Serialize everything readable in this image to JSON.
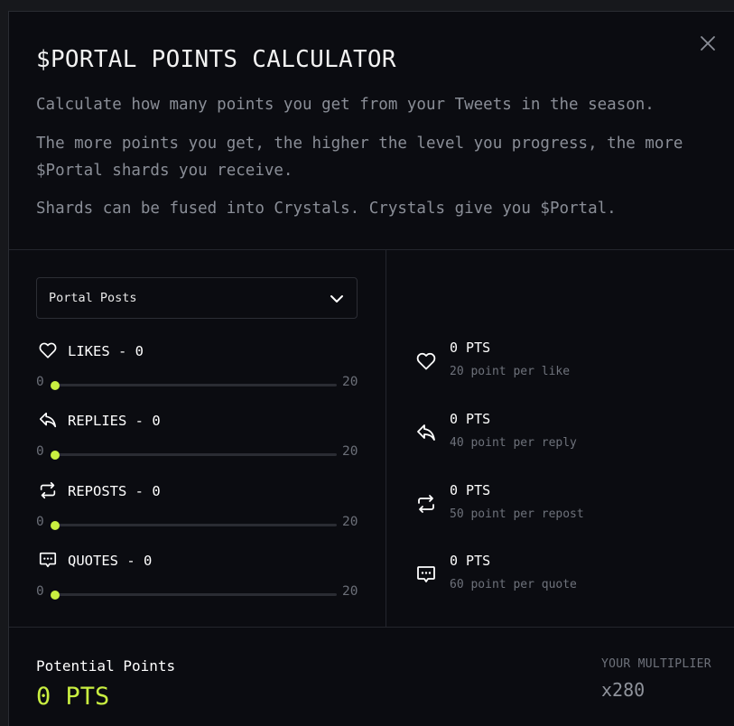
{
  "modal": {
    "title": "$PORTAL POINTS CALCULATOR",
    "paragraphs": [
      "Calculate how many points you get from your Tweets in the season.",
      "The more points you get, the higher the level you progress, the more $Portal shards you receive.",
      "Shards can be fused into Crystals. Crystals give you $Portal."
    ],
    "close_icon": "close-icon"
  },
  "dropdown": {
    "selected": "Portal Posts",
    "icon": "chevron-down-icon"
  },
  "metrics": [
    {
      "label": "LIKES - 0",
      "icon": "heart-icon",
      "min": "0",
      "max": "20",
      "value": 0
    },
    {
      "label": "REPLIES - 0",
      "icon": "reply-icon",
      "min": "0",
      "max": "20",
      "value": 0
    },
    {
      "label": "REPOSTS - 0",
      "icon": "repost-icon",
      "min": "0",
      "max": "20",
      "value": 0
    },
    {
      "label": "QUOTES - 0",
      "icon": "quote-icon",
      "min": "0",
      "max": "20",
      "value": 0
    }
  ],
  "points": [
    {
      "value": "0 PTS",
      "desc": "20 point per like",
      "icon": "heart-icon"
    },
    {
      "value": "0 PTS",
      "desc": "40 point per reply",
      "icon": "reply-icon"
    },
    {
      "value": "0 PTS",
      "desc": "50 point per repost",
      "icon": "repost-icon"
    },
    {
      "value": "0 PTS",
      "desc": "60 point per quote",
      "icon": "quote-icon"
    }
  ],
  "footer": {
    "potential_label": "Potential Points",
    "potential_value": "0 PTS",
    "multiplier_label": "YOUR MULTIPLIER",
    "multiplier_value": "x280"
  },
  "colors": {
    "accent": "#c9ef41",
    "background": "#0b0c11",
    "muted_text": "#8a8e97"
  }
}
